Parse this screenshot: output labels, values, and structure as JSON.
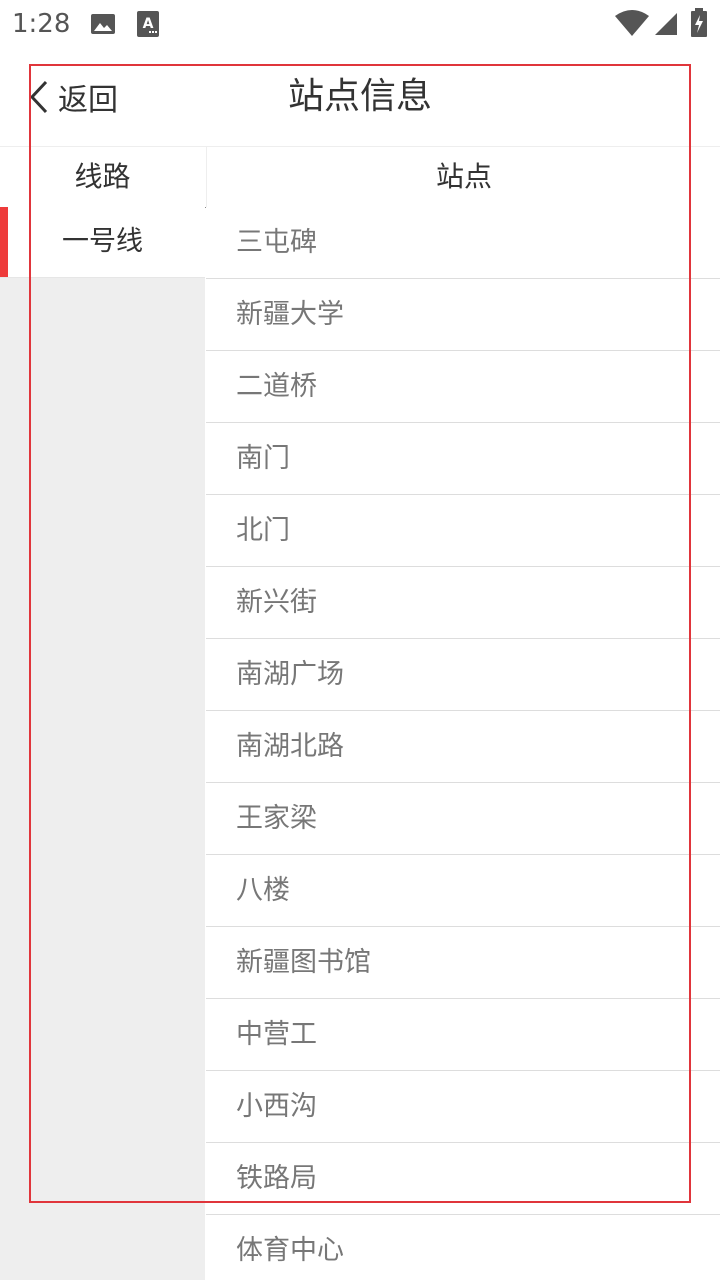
{
  "status_bar": {
    "time": "1:28",
    "icons": [
      "gallery-icon",
      "font-icon",
      "wifi-icon",
      "signal-icon",
      "battery-icon"
    ]
  },
  "header": {
    "back_label": "返回",
    "title": "站点信息"
  },
  "columns": {
    "line": "线路",
    "station": "站点"
  },
  "lines": [
    {
      "label": "一号线",
      "selected": true
    }
  ],
  "stations": [
    "三屯碑",
    "新疆大学",
    "二道桥",
    "南门",
    "北门",
    "新兴街",
    "南湖广场",
    "南湖北路",
    "王家梁",
    "八楼",
    "新疆图书馆",
    "中营工",
    "小西沟",
    "铁路局",
    "体育中心"
  ],
  "colors": {
    "accent": "#ee3b3b",
    "highlight_border": "#e0353b",
    "panel_bg": "#eeeeee",
    "station_text": "#777777",
    "primary_text": "#333333"
  }
}
